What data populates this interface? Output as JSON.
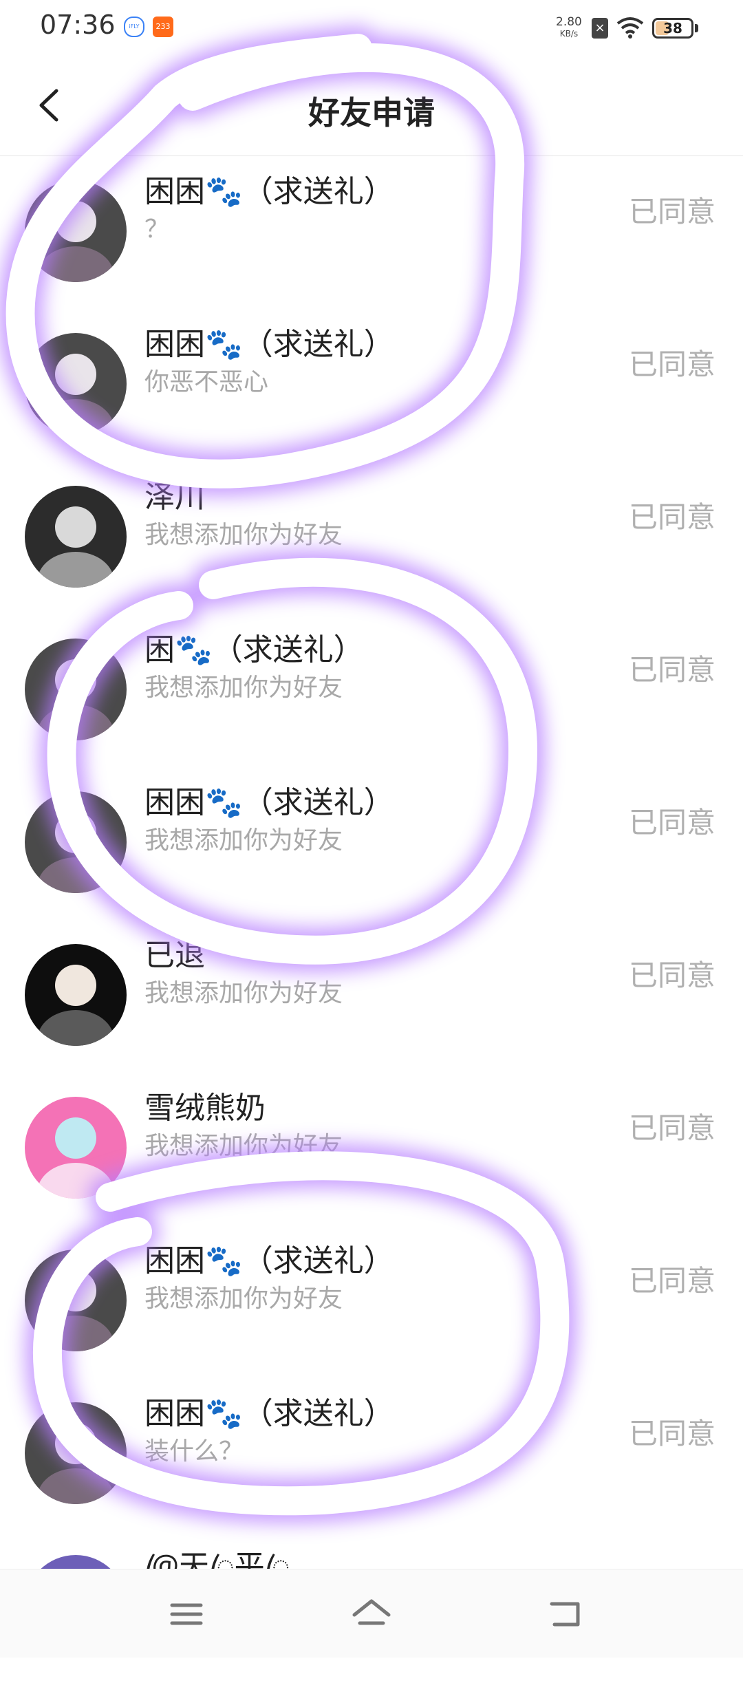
{
  "status_bar": {
    "time": "07:36",
    "app_icons": [
      {
        "name": "ifly-icon",
        "label": "iFLY"
      },
      {
        "name": "bilibili-233-icon",
        "label": "233"
      }
    ],
    "net_speed_value": "2.80",
    "net_speed_unit": "KB/s",
    "battery_level": "38"
  },
  "header": {
    "title": "好友申请",
    "back_icon": "chevron-left-icon"
  },
  "requests": [
    {
      "name": "困困",
      "emoji": "🐾",
      "suffix": "（求送礼）",
      "message": "？",
      "status": "已同意",
      "avatar": "dark"
    },
    {
      "name": "困困",
      "emoji": "🐾",
      "suffix": "（求送礼）",
      "message": "你恶不恶心",
      "status": "已同意",
      "avatar": "dark"
    },
    {
      "name": "泽川",
      "emoji": "",
      "suffix": "",
      "message": "我想添加你为好友",
      "status": "已同意",
      "avatar": "gray"
    },
    {
      "name": "困",
      "emoji": "🐾",
      "suffix": "（求送礼）",
      "message": "我想添加你为好友",
      "status": "已同意",
      "avatar": "dark"
    },
    {
      "name": "困困",
      "emoji": "🐾",
      "suffix": "（求送礼）",
      "message": "我想添加你为好友",
      "status": "已同意",
      "avatar": "dark"
    },
    {
      "name": "已退",
      "emoji": "",
      "suffix": "",
      "message": "我想添加你为好友",
      "status": "已同意",
      "avatar": "black"
    },
    {
      "name": "雪绒熊奶",
      "emoji": "",
      "suffix": "",
      "message": "我想添加你为好友",
      "status": "已同意",
      "avatar": "pink"
    },
    {
      "name": "困困",
      "emoji": "🐾",
      "suffix": "（求送礼）",
      "message": "我想添加你为好友",
      "status": "已同意",
      "avatar": "dark"
    },
    {
      "name": "困困",
      "emoji": "🐾",
      "suffix": "（求送礼）",
      "message": "装什么？",
      "status": "已同意",
      "avatar": "dark"
    },
    {
      "name": "@ꦿ天ꦿ平ꦿ",
      "emoji": "",
      "suffix": "",
      "message": "",
      "status": "",
      "avatar": "purple"
    }
  ],
  "nav_bar": {
    "buttons": [
      "menu-icon",
      "home-icon",
      "back-icon"
    ]
  },
  "colors": {
    "accent_paw": "#2f6bd8",
    "annotation_glow": "#b57cff",
    "muted_text": "#a8a8a8"
  }
}
